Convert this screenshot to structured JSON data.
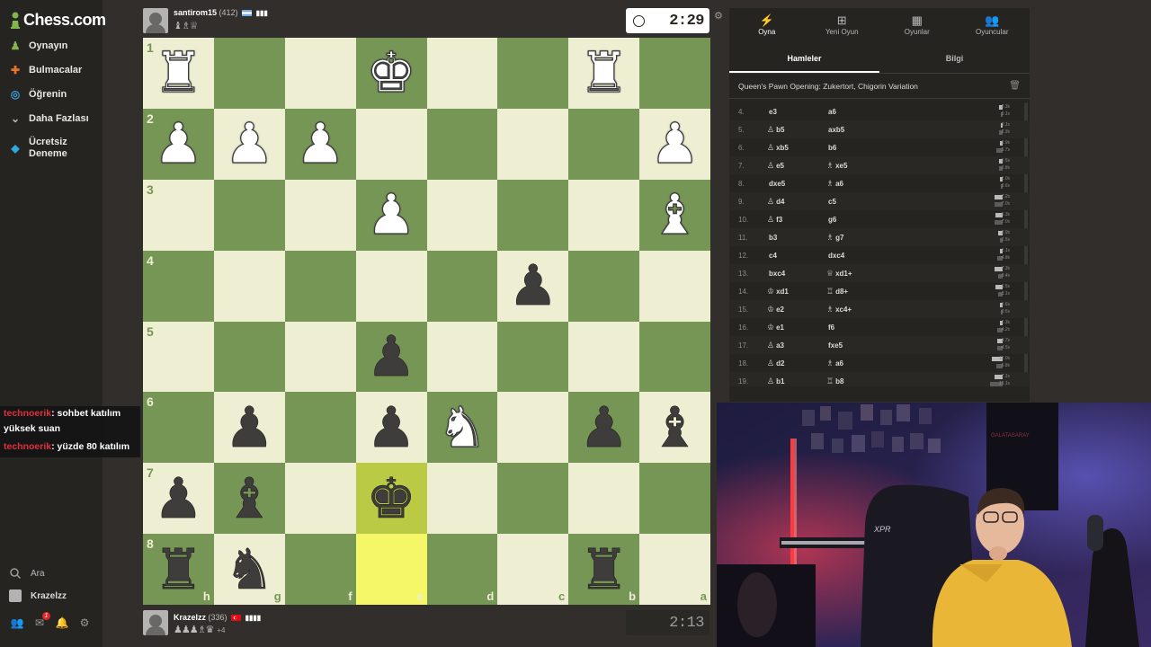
{
  "brand": {
    "logo_text": "Chess.com"
  },
  "sidebar": {
    "items": [
      {
        "label": "Oynayın",
        "icon": "play-icon",
        "color": "#81b64c"
      },
      {
        "label": "Bulmacalar",
        "icon": "puzzle-icon",
        "color": "#e8722c"
      },
      {
        "label": "Öğrenin",
        "icon": "learn-icon",
        "color": "#3a9fd8"
      },
      {
        "label": "Daha Fazlası",
        "icon": "chevron-down-icon",
        "color": "#bababa"
      },
      {
        "label": "Ücretsiz Deneme",
        "icon": "diamond-icon",
        "color": "#2fa8e0"
      }
    ],
    "search_label": "Ara",
    "user_label": "Krazelzz",
    "notification_count": "1"
  },
  "chat": [
    {
      "user": "technoerik",
      "text": ": sohbet katılım yüksek suan"
    },
    {
      "user": "technoerik",
      "text": ": yüzde 80 katılım"
    }
  ],
  "top_player": {
    "name": "santirom15",
    "rating": "(412)",
    "captured": "♝♗♕",
    "clock": "2:29"
  },
  "bottom_player": {
    "name": "Krazelzz",
    "rating": "(336)",
    "captured": "♟♟♟♗♛",
    "advantage": "+4",
    "clock": "2:13"
  },
  "board": {
    "light_color": "#eeeed2",
    "dark_color": "#769656",
    "highlight_color": "#f6f669",
    "ranks": [
      "1",
      "2",
      "3",
      "4",
      "5",
      "6",
      "7",
      "8"
    ],
    "files": [
      "h",
      "g",
      "f",
      "e",
      "d",
      "c",
      "b",
      "a"
    ],
    "rows": [
      [
        "wR",
        "",
        "",
        "wK",
        "",
        "",
        "wR",
        ""
      ],
      [
        "wP",
        "wP",
        "wP",
        "",
        "",
        "",
        "",
        "wP"
      ],
      [
        "",
        "",
        "",
        "wP",
        "",
        "",
        "",
        "wB"
      ],
      [
        "",
        "",
        "",
        "",
        "",
        "bP",
        "",
        ""
      ],
      [
        "",
        "",
        "",
        "bP",
        "",
        "",
        "",
        ""
      ],
      [
        "",
        "bP",
        "",
        "bP",
        "wN",
        "",
        "bP",
        "bB"
      ],
      [
        "bP",
        "bB",
        "",
        "bK",
        "",
        "",
        "",
        ""
      ],
      [
        "bR",
        "bN",
        "",
        "",
        "",
        "",
        "bR",
        ""
      ]
    ]
  },
  "panel": {
    "tabs": [
      {
        "label": "Oyna",
        "icon": "lightning-icon"
      },
      {
        "label": "Yeni Oyun",
        "icon": "plus-icon"
      },
      {
        "label": "Oyunlar",
        "icon": "board-icon"
      },
      {
        "label": "Oyuncular",
        "icon": "players-icon"
      }
    ],
    "subtabs": [
      "Hamleler",
      "Bilgi"
    ],
    "opening": "Queen's Pawn Opening: Zukertort, Chigorin Variation",
    "moves": [
      {
        "num": "4.",
        "w_piece": "",
        "w": "e3",
        "b_piece": "",
        "b": "a6",
        "tw": "2.3s",
        "tb": "0.1s",
        "bw": 4,
        "bb": 2
      },
      {
        "num": "5.",
        "w_piece": "♙",
        "w": "b5",
        "b_piece": "",
        "b": "axb5",
        "tw": "0.1s",
        "tb": "2.3s",
        "bw": 2,
        "bb": 4
      },
      {
        "num": "6.",
        "w_piece": "♙",
        "w": "xb5",
        "b_piece": "",
        "b": "b6",
        "tw": "0.9s",
        "tb": "5.7s",
        "bw": 3,
        "bb": 7
      },
      {
        "num": "7.",
        "w_piece": "♙",
        "w": "e5",
        "b_piece": "♗",
        "b": "xe5",
        "tw": "1.5s",
        "tb": "1.8s",
        "bw": 4,
        "bb": 4
      },
      {
        "num": "8.",
        "w_piece": "",
        "w": "dxe5",
        "b_piece": "♗",
        "b": "a6",
        "tw": "1.0s",
        "tb": "0.6s",
        "bw": 3,
        "bb": 2
      },
      {
        "num": "9.",
        "w_piece": "♙",
        "w": "d4",
        "b_piece": "",
        "b": "c5",
        "tw": "7.2s",
        "tb": "7.0s",
        "bw": 9,
        "bb": 9
      },
      {
        "num": "10.",
        "w_piece": "♙",
        "w": "f3",
        "b_piece": "",
        "b": "g6",
        "tw": "5.3s",
        "tb": "7.0s",
        "bw": 8,
        "bb": 9
      },
      {
        "num": "11.",
        "w_piece": "",
        "w": "b3",
        "b_piece": "♗",
        "b": "g7",
        "tw": "2.9s",
        "tb": "1.5s",
        "bw": 5,
        "bb": 3
      },
      {
        "num": "12.",
        "w_piece": "",
        "w": "c4",
        "b_piece": "",
        "b": "dxc4",
        "tw": "1.1s",
        "tb": "4.8s",
        "bw": 3,
        "bb": 6
      },
      {
        "num": "13.",
        "w_piece": "",
        "w": "bxc4",
        "b_piece": "♕",
        "b": "xd1+",
        "tw": "7.3s",
        "tb": "3.4s",
        "bw": 9,
        "bb": 5
      },
      {
        "num": "14.",
        "w_piece": "♔",
        "w": "xd1",
        "b_piece": "♖",
        "b": "d8+",
        "tw": "5.5s",
        "tb": "3.1s",
        "bw": 8,
        "bb": 5
      },
      {
        "num": "15.",
        "w_piece": "♔",
        "w": "e2",
        "b_piece": "♗",
        "b": "xc4+",
        "tw": "1.6s",
        "tb": "0.5s",
        "bw": 3,
        "bb": 2
      },
      {
        "num": "16.",
        "w_piece": "♔",
        "w": "e1",
        "b_piece": "",
        "b": "f6",
        "tw": "1.3s",
        "tb": "4.2s",
        "bw": 3,
        "bb": 6
      },
      {
        "num": "17.",
        "w_piece": "♙",
        "w": "a3",
        "b_piece": "",
        "b": "fxe5",
        "tw": "3.7s",
        "tb": "4.5s",
        "bw": 6,
        "bb": 6
      },
      {
        "num": "18.",
        "w_piece": "♙",
        "w": "d2",
        "b_piece": "♗",
        "b": "a6",
        "tw": "11.0s",
        "tb": "5.8s",
        "bw": 12,
        "bb": 7
      },
      {
        "num": "19.",
        "w_piece": "♙",
        "w": "b1",
        "b_piece": "♖",
        "b": "b8",
        "tw": "7.1s",
        "tb": "15.1s",
        "bw": 9,
        "bb": 14
      }
    ]
  },
  "webcam": {
    "poster_text": "GALATASARAY"
  }
}
